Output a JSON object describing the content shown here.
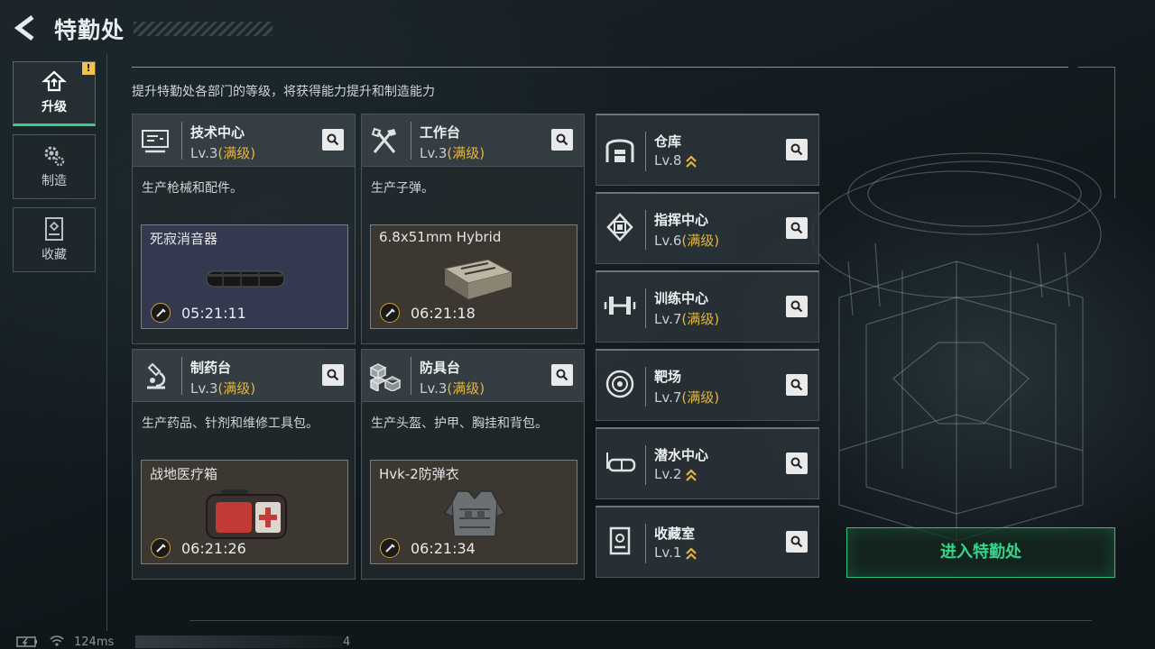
{
  "header": {
    "title": "特勤处"
  },
  "side_nav": [
    {
      "label": "升级",
      "icon": "upgrade-icon",
      "active": true,
      "alert": "!"
    },
    {
      "label": "制造",
      "icon": "gears-icon",
      "active": false
    },
    {
      "label": "收藏",
      "icon": "collection-icon",
      "active": false
    }
  ],
  "description": "提升特勤处各部门的等级，将获得能力提升和制造能力",
  "workshops": [
    {
      "name": "技术中心",
      "level": "Lv.3",
      "status": "(满级)",
      "desc": "生产枪械和配件。",
      "product": "死寂消音器",
      "timer": "05:21:11",
      "icon": "computer-icon",
      "product_icon": "silencer-image"
    },
    {
      "name": "工作台",
      "level": "Lv.3",
      "status": "(满级)",
      "desc": "生产子弹。",
      "product": "6.8x51mm Hybrid",
      "timer": "06:21:18",
      "icon": "tools-icon",
      "product_icon": "ammo-box-image"
    },
    {
      "name": "制药台",
      "level": "Lv.3",
      "status": "(满级)",
      "desc": "生产药品、针剂和维修工具包。",
      "product": "战地医疗箱",
      "timer": "06:21:26",
      "icon": "microscope-icon",
      "product_icon": "medkit-image"
    },
    {
      "name": "防具台",
      "level": "Lv.3",
      "status": "(满级)",
      "desc": "生产头盔、护甲、胸挂和背包。",
      "product": "Hvk-2防弹衣",
      "timer": "06:21:34",
      "icon": "cubes-icon",
      "product_icon": "armor-vest-image"
    }
  ],
  "facilities": [
    {
      "name": "仓库",
      "level": "Lv.8",
      "status": "",
      "upgradable": true,
      "icon": "warehouse-icon"
    },
    {
      "name": "指挥中心",
      "level": "Lv.6",
      "status": "(满级)",
      "upgradable": false,
      "icon": "chip-icon"
    },
    {
      "name": "训练中心",
      "level": "Lv.7",
      "status": "(满级)",
      "upgradable": false,
      "icon": "dumbbell-icon"
    },
    {
      "name": "靶场",
      "level": "Lv.7",
      "status": "(满级)",
      "upgradable": false,
      "icon": "target-icon"
    },
    {
      "name": "潜水中心",
      "level": "Lv.2",
      "status": "",
      "upgradable": true,
      "icon": "goggles-icon"
    },
    {
      "name": "收藏室",
      "level": "Lv.1",
      "status": "",
      "upgradable": true,
      "icon": "collection-room-icon"
    }
  ],
  "enter_button": "进入特勤处",
  "status_bar": {
    "ping": "124ms",
    "uid_suffix": "4"
  },
  "colors": {
    "accent_green": "#35d58a",
    "max_level_gold": "#e3b53f",
    "alert_yellow": "#f2c14e"
  }
}
